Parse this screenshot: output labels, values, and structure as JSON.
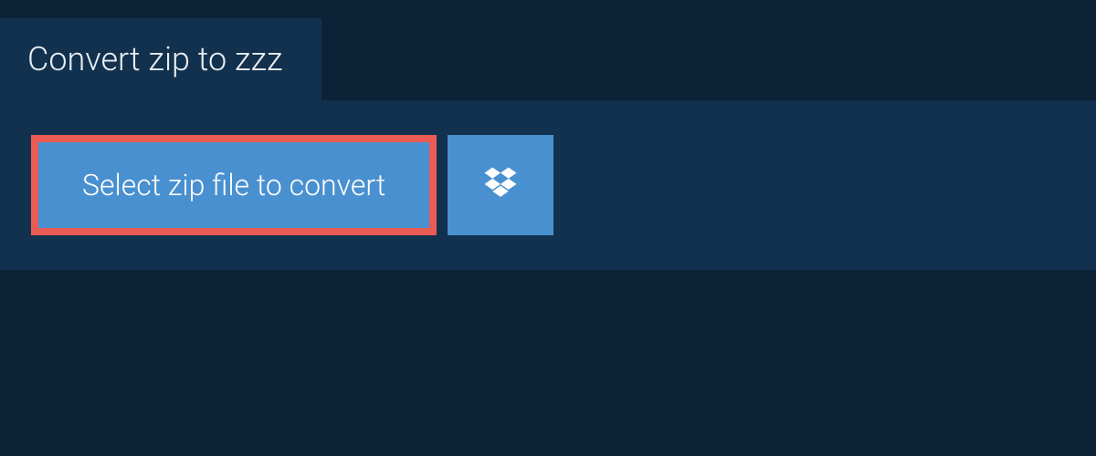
{
  "header": {
    "title": "Convert zip to zzz"
  },
  "actions": {
    "select_file_label": "Select zip file to convert"
  }
}
